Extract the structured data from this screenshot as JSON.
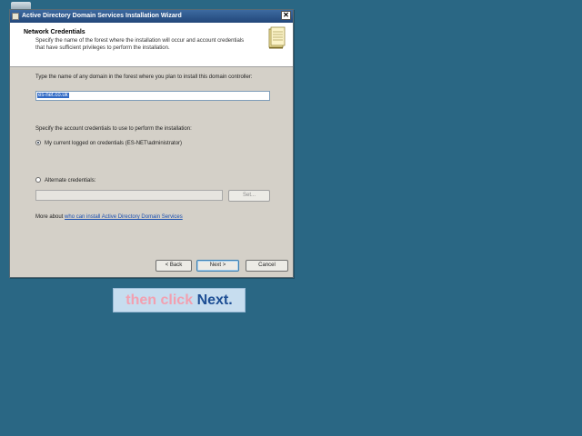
{
  "window": {
    "title": "Active Directory Domain Services Installation Wizard",
    "close_glyph": "✕"
  },
  "header": {
    "title": "Network Credentials",
    "description": "Specify the name of the forest where the installation will occur and account credentials that have sufficient privileges to perform the installation."
  },
  "domain": {
    "label": "Type the name of any domain in the forest where you plan to install this domain controller:",
    "value": "es-net.co.uk"
  },
  "credentials": {
    "label": "Specify the account credentials to use to perform the installation:",
    "current_option": "My current logged on credentials (ES-NET\\administrator)",
    "current_selected": true,
    "alternate_option": "Alternate credentials:",
    "alternate_selected": false,
    "alternate_value": "",
    "set_button": "Set..."
  },
  "help": {
    "prefix": "More about ",
    "link_text": "who can install Active Directory Domain Services"
  },
  "buttons": {
    "back": "< Back",
    "next": "Next >",
    "cancel": "Cancel"
  },
  "caption": {
    "part1": "then click",
    "part2": "Next."
  },
  "icons": {
    "title": "wizard-icon",
    "header": "book-icon",
    "desktop": "desktop-shortcut-icon"
  }
}
